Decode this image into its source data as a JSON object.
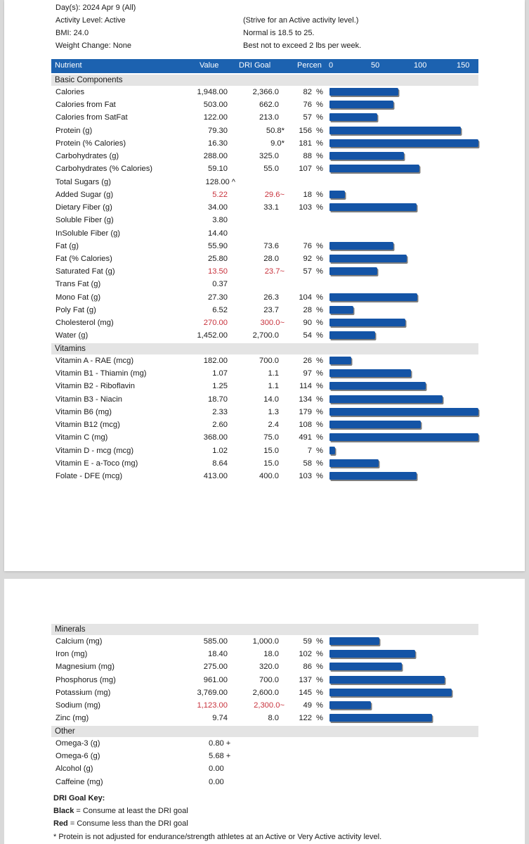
{
  "summary": {
    "days": "Day(s):  2024 Apr 9 (All)",
    "activity_level": "Activity Level: Active",
    "bmi": "BMI: 24.0",
    "weight_change": "Weight Change: None",
    "activity_note": "(Strive for an Active activity level.)",
    "bmi_note": "Normal is 18.5 to 25.",
    "weight_note": "Best not to exceed 2 lbs per week."
  },
  "table_header": {
    "nutrient": "Nutrient",
    "value": "Value",
    "dri_goal": "DRI Goal",
    "percent": "Percen",
    "scale_ticks": [
      "0",
      "50",
      "100",
      "150"
    ]
  },
  "colors": {
    "header_blue": "#1c62b0",
    "bar_blue": "#1454a6",
    "below_goal_red": "#c8323c",
    "section_gray": "#e4e4e4"
  },
  "sections": [
    {
      "title": "Basic Components",
      "rows": [
        {
          "name": "Calories",
          "value": "1,948.00",
          "goal": "2,366.0",
          "percent": 82
        },
        {
          "name": "Calories from Fat",
          "value": "503.00",
          "goal": "662.0",
          "percent": 76
        },
        {
          "name": "Calories from SatFat",
          "value": "122.00",
          "goal": "213.0",
          "percent": 57
        },
        {
          "name": "Protein (g)",
          "value": "79.30",
          "goal": "50.8*",
          "percent": 156
        },
        {
          "name": "Protein (% Calories)",
          "value": "16.30",
          "goal": "9.0*",
          "percent": 181
        },
        {
          "name": "Carbohydrates (g)",
          "value": "288.00",
          "goal": "325.0",
          "percent": 88
        },
        {
          "name": "Carbohydrates (% Calories)",
          "value": "59.10",
          "goal": "55.0",
          "percent": 107
        },
        {
          "name": "Total Sugars (g)",
          "value": "128.00",
          "value_suffix": "^"
        },
        {
          "name": "Added Sugar (g)",
          "value": "5.22",
          "goal": "29.6~",
          "percent": 18,
          "red": true
        },
        {
          "name": "Dietary Fiber (g)",
          "value": "34.00",
          "goal": "33.1",
          "percent": 103
        },
        {
          "name": "Soluble Fiber (g)",
          "value": "3.80"
        },
        {
          "name": "InSoluble Fiber (g)",
          "value": "14.40"
        },
        {
          "name": "Fat (g)",
          "value": "55.90",
          "goal": "73.6",
          "percent": 76
        },
        {
          "name": "Fat (% Calories)",
          "value": "25.80",
          "goal": "28.0",
          "percent": 92
        },
        {
          "name": "Saturated Fat (g)",
          "value": "13.50",
          "goal": "23.7~",
          "percent": 57,
          "red": true
        },
        {
          "name": "Trans Fat (g)",
          "value": "0.37"
        },
        {
          "name": "Mono Fat (g)",
          "value": "27.30",
          "goal": "26.3",
          "percent": 104
        },
        {
          "name": "Poly Fat (g)",
          "value": "6.52",
          "goal": "23.7",
          "percent": 28
        },
        {
          "name": "Cholesterol (mg)",
          "value": "270.00",
          "goal": "300.0~",
          "percent": 90,
          "red": true
        },
        {
          "name": "Water (g)",
          "value": "1,452.00",
          "goal": "2,700.0",
          "percent": 54
        }
      ]
    },
    {
      "title": "Vitamins",
      "rows": [
        {
          "name": "Vitamin A - RAE (mcg)",
          "value": "182.00",
          "goal": "700.0",
          "percent": 26
        },
        {
          "name": "Vitamin B1 - Thiamin (mg)",
          "value": "1.07",
          "goal": "1.1",
          "percent": 97
        },
        {
          "name": "Vitamin B2 - Riboflavin",
          "value": "1.25",
          "goal": "1.1",
          "percent": 114
        },
        {
          "name": "Vitamin B3 - Niacin",
          "value": "18.70",
          "goal": "14.0",
          "percent": 134
        },
        {
          "name": "Vitamin B6 (mg)",
          "value": "2.33",
          "goal": "1.3",
          "percent": 179
        },
        {
          "name": "Vitamin B12 (mcg)",
          "value": "2.60",
          "goal": "2.4",
          "percent": 108
        },
        {
          "name": "Vitamin C (mg)",
          "value": "368.00",
          "goal": "75.0",
          "percent": 491
        },
        {
          "name": "Vitamin D - mcg (mcg)",
          "value": "1.02",
          "goal": "15.0",
          "percent": 7
        },
        {
          "name": "Vitamin E - a-Toco (mg)",
          "value": "8.64",
          "goal": "15.0",
          "percent": 58
        },
        {
          "name": "Folate - DFE (mcg)",
          "value": "413.00",
          "goal": "400.0",
          "percent": 103
        }
      ]
    },
    {
      "title": "Minerals",
      "rows": [
        {
          "name": "Calcium (mg)",
          "value": "585.00",
          "goal": "1,000.0",
          "percent": 59
        },
        {
          "name": "Iron (mg)",
          "value": "18.40",
          "goal": "18.0",
          "percent": 102
        },
        {
          "name": "Magnesium (mg)",
          "value": "275.00",
          "goal": "320.0",
          "percent": 86
        },
        {
          "name": "Phosphorus (mg)",
          "value": "961.00",
          "goal": "700.0",
          "percent": 137
        },
        {
          "name": "Potassium (mg)",
          "value": "3,769.00",
          "goal": "2,600.0",
          "percent": 145
        },
        {
          "name": "Sodium (mg)",
          "value": "1,123.00",
          "goal": "2,300.0~",
          "percent": 49,
          "red": true
        },
        {
          "name": "Zinc (mg)",
          "value": "9.74",
          "goal": "8.0",
          "percent": 122
        }
      ]
    },
    {
      "title": "Other",
      "rows": [
        {
          "name": "Omega-3 (g)",
          "value": "0.80",
          "value_suffix": "+"
        },
        {
          "name": "Omega-6 (g)",
          "value": "5.68",
          "value_suffix": "+"
        },
        {
          "name": "Alcohol (g)",
          "value": "0.00"
        },
        {
          "name": "Caffeine (mg)",
          "value": "0.00"
        }
      ]
    }
  ],
  "percent_scale_max": 177,
  "percent_sign": "%",
  "dri_key": {
    "title": "DRI Goal Key:",
    "black_label": "Black",
    "black_text": " = Consume at least the DRI goal",
    "red_label": "Red",
    "red_text": " = Consume less than the DRI goal",
    "footnote": "* Protein is not adjusted for endurance/strength athletes at an Active or Very Active activity level."
  }
}
